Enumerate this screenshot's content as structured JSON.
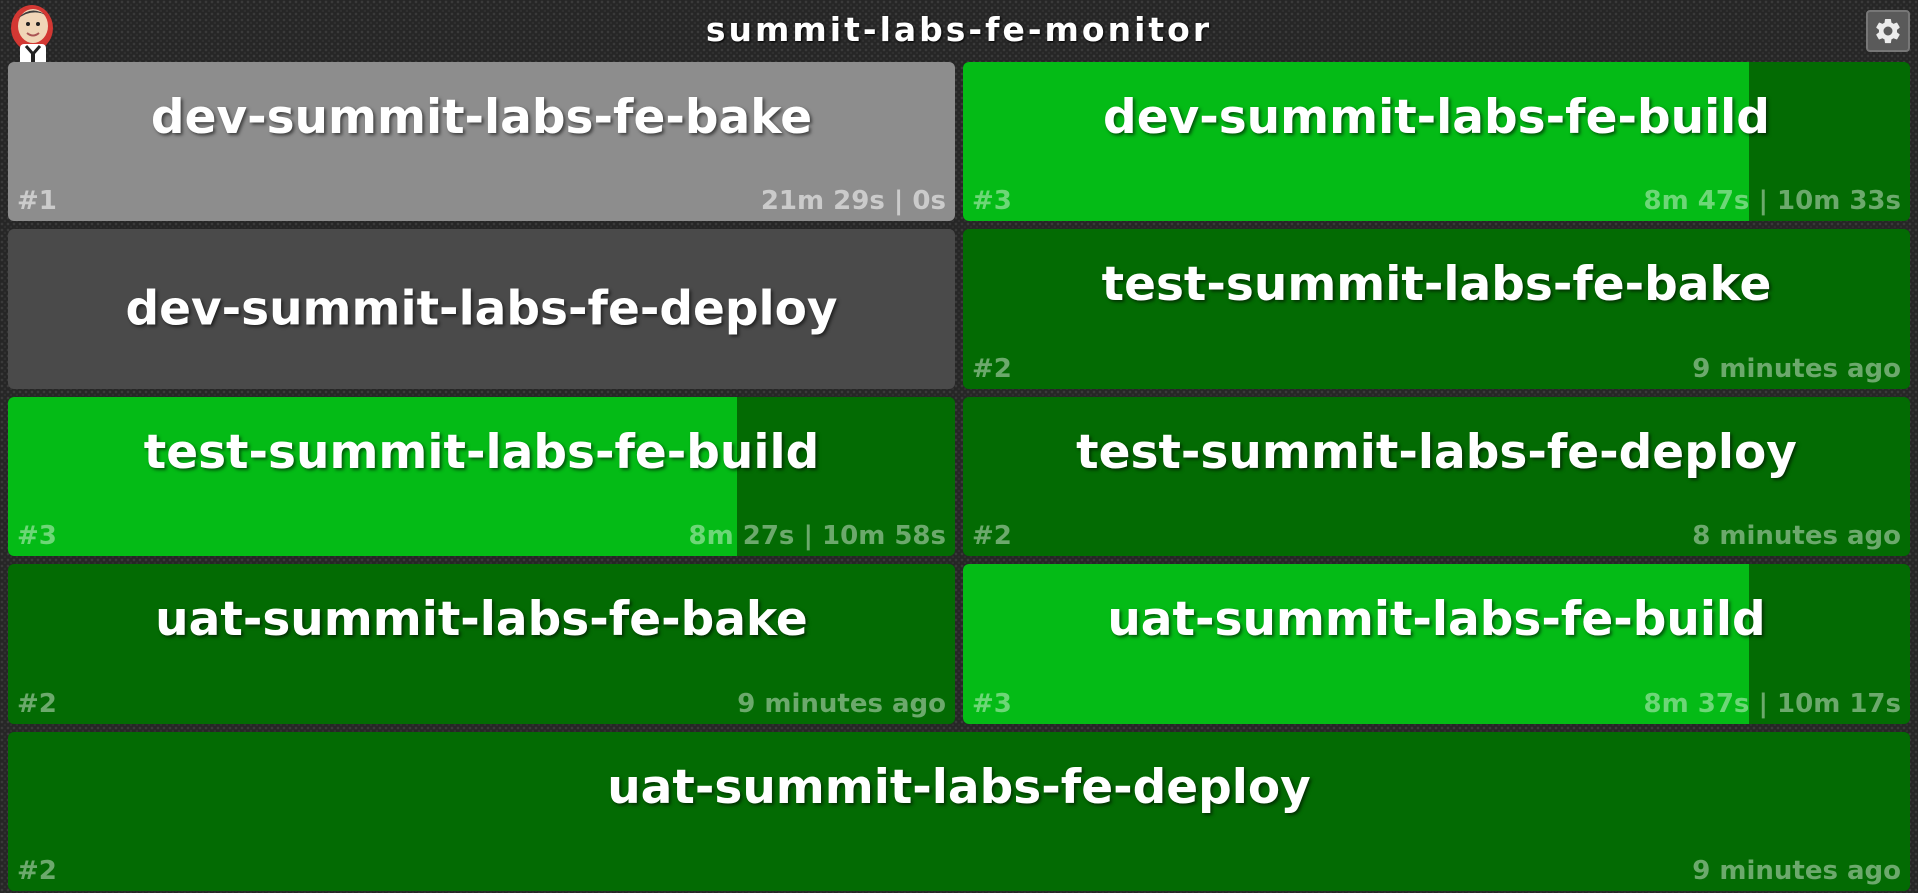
{
  "header": {
    "title": "summit-labs-fe-monitor",
    "logo_icon": "jenkins-butler-logo",
    "settings_icon": "gear-icon"
  },
  "colors": {
    "success": "#036b03",
    "building_progress": "#04bb16",
    "disabled": "#8d8d8d",
    "not_built": "#4a4a4a",
    "background": "#262626"
  },
  "jobs": [
    {
      "name": "dev-summit-labs-fe-bake",
      "build": "#1",
      "info": "21m 29s | 0s",
      "status": "disabled",
      "progress": null
    },
    {
      "name": "dev-summit-labs-fe-build",
      "build": "#3",
      "info": "8m 47s | 10m 33s",
      "status": "building",
      "progress": 0.83
    },
    {
      "name": "dev-summit-labs-fe-deploy",
      "build": "",
      "info": "",
      "status": "not_built",
      "progress": null
    },
    {
      "name": "test-summit-labs-fe-bake",
      "build": "#2",
      "info": "9 minutes ago",
      "status": "success",
      "progress": null
    },
    {
      "name": "test-summit-labs-fe-build",
      "build": "#3",
      "info": "8m 27s | 10m 58s",
      "status": "building",
      "progress": 0.77
    },
    {
      "name": "test-summit-labs-fe-deploy",
      "build": "#2",
      "info": "8 minutes ago",
      "status": "success",
      "progress": null
    },
    {
      "name": "uat-summit-labs-fe-bake",
      "build": "#2",
      "info": "9 minutes ago",
      "status": "success",
      "progress": null
    },
    {
      "name": "uat-summit-labs-fe-build",
      "build": "#3",
      "info": "8m 37s | 10m 17s",
      "status": "building",
      "progress": 0.83
    },
    {
      "name": "uat-summit-labs-fe-deploy",
      "build": "#2",
      "info": "9 minutes ago",
      "status": "success",
      "progress": null
    }
  ]
}
